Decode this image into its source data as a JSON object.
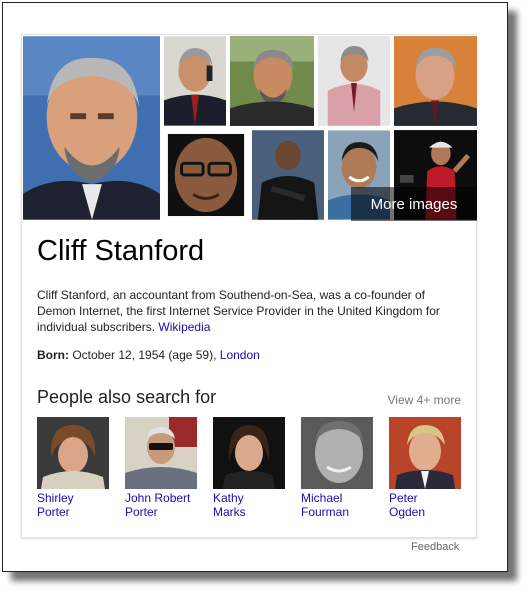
{
  "entity": {
    "title": "Cliff Stanford",
    "description": "Cliff Stanford, an accountant from Southend-on-Sea, was a co-founder of Demon Internet, the first Internet Service Provider in the United Kingdom for individual subscribers.",
    "source_link": "Wikipedia",
    "born_label": "Born:",
    "born_value": "October 12, 1954 (age 59),",
    "born_place": "London"
  },
  "images": {
    "more_label": "More images"
  },
  "related": {
    "heading": "People also search for",
    "view_more": "View 4+ more",
    "people": [
      {
        "line1": "Shirley",
        "line2": "Porter"
      },
      {
        "line1": "John Robert",
        "line2": "Porter"
      },
      {
        "line1": "Kathy",
        "line2": "Marks"
      },
      {
        "line1": "Michael",
        "line2": "Fourman"
      },
      {
        "line1": "Peter",
        "line2": "Ogden"
      }
    ]
  },
  "footer": {
    "feedback": "Feedback"
  },
  "colors": {
    "link": "#1a0dab",
    "muted": "#777777"
  }
}
